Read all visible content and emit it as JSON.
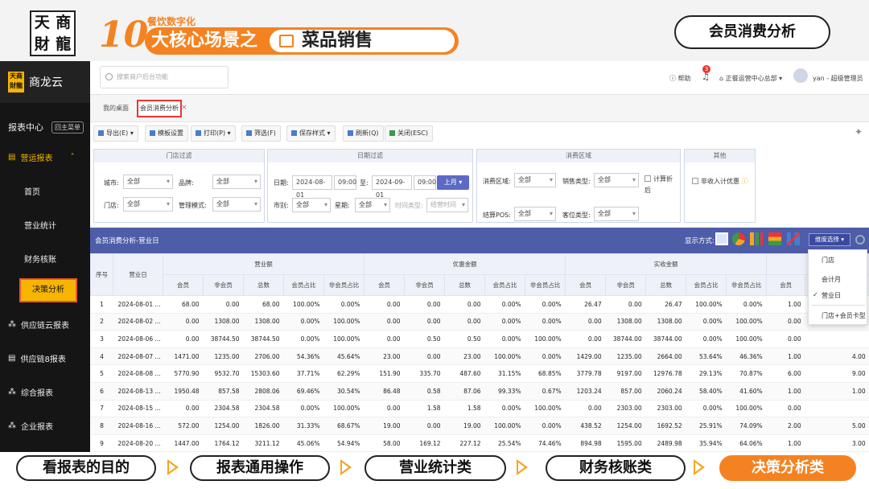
{
  "banner": {
    "logo": [
      "天",
      "商",
      "財",
      "龍"
    ],
    "big_number": "10",
    "small_title": "餐饮数字化",
    "main_title": "大核心场景之",
    "pill_title": "菜品销售",
    "topic": "会员消费分析"
  },
  "sidebar": {
    "brand": "商龙云",
    "brand_mini": "天商財龍",
    "report_center": "报表中心",
    "home_btn": "回主菜单",
    "group": "营运报表",
    "subs": [
      "首页",
      "营业统计",
      "财务核账",
      "决策分析"
    ],
    "others": [
      "供应链云报表",
      "供应链8报表",
      "综合报表",
      "企业报表"
    ]
  },
  "header": {
    "search_placeholder": "搜索商户后台功能",
    "help": "帮助",
    "bell_count": "3",
    "org": "正餐运营中心总部",
    "user": "yan - 超级管理员"
  },
  "tabs": {
    "desk": "我的桌面",
    "current": "会员消费分析",
    "close": "×"
  },
  "toolbar": [
    "导出(E)",
    "模板设置",
    "打印(P)",
    "筛选(F)",
    "保存样式",
    "刷新(Q)",
    "关闭(ESC)"
  ],
  "filters": {
    "store": {
      "head": "门店过滤",
      "city_lbl": "城市:",
      "city": "全部",
      "brand_lbl": "品牌:",
      "brand": "全部",
      "store_lbl": "门店:",
      "store": "全部",
      "mode_lbl": "管理模式:",
      "mode": "全部"
    },
    "date": {
      "head": "日期过滤",
      "date_lbl": "日期:",
      "start": "2024-08-01",
      "start_t": "09:00",
      "to": "至:",
      "end": "2024-09-01",
      "end_t": "09:00",
      "month_btn": "上月 ▾",
      "market_lbl": "市别:",
      "market": "全部",
      "week_lbl": "星期:",
      "week": "全部",
      "time_lbl": "时间类型:",
      "time": "结营时间"
    },
    "consume": {
      "head": "消费区域",
      "area_lbl": "消费区域:",
      "area": "全部",
      "sale_lbl": "销售类型:",
      "sale": "全部",
      "disc_lbl": "计算折后",
      "pos_lbl": "结算POS:",
      "pos": "全部",
      "seat_lbl": "客位类型:",
      "seat": "全部"
    },
    "other": {
      "head": "其他",
      "exclude": "非收入计优惠"
    }
  },
  "grid": {
    "title": "会员消费分析-营业日",
    "display_label": "显示方式:",
    "dim_btn": "维度选择 ▾",
    "col_index": "序号",
    "col_day": "营业日",
    "groups": [
      "营业额",
      "优惠金额",
      "实收金额"
    ],
    "sub_cols": [
      "会员",
      "非会员",
      "总数",
      "会员占比",
      "非会员占比"
    ],
    "extra_col": "会员",
    "rows": [
      [
        "1",
        "2024-08-01 ...",
        "68.00",
        "0.00",
        "68.00",
        "100.00%",
        "0.00%",
        "0.00",
        "0.00",
        "0.00",
        "0.00%",
        "0.00%",
        "26.47",
        "0.00",
        "26.47",
        "100.00%",
        "0.00%",
        "1.00"
      ],
      [
        "2",
        "2024-08-02 ...",
        "0.00",
        "1308.00",
        "1308.00",
        "0.00%",
        "100.00%",
        "0.00",
        "0.00",
        "0.00",
        "0.00%",
        "0.00%",
        "0.00",
        "1308.00",
        "1308.00",
        "0.00%",
        "100.00%",
        "0.00"
      ],
      [
        "3",
        "2024-08-06 ...",
        "0.00",
        "38744.50",
        "38744.50",
        "0.00%",
        "100.00%",
        "0.00",
        "0.50",
        "0.50",
        "0.00%",
        "100.00%",
        "0.00",
        "38744.00",
        "38744.00",
        "0.00%",
        "100.00%",
        "0.00"
      ],
      [
        "4",
        "2024-08-07 ...",
        "1471.00",
        "1235.00",
        "2706.00",
        "54.36%",
        "45.64%",
        "23.00",
        "0.00",
        "23.00",
        "100.00%",
        "0.00%",
        "1429.00",
        "1235.00",
        "2664.00",
        "53.64%",
        "46.36%",
        "1.00"
      ],
      [
        "5",
        "2024-08-08 ...",
        "5770.90",
        "9532.70",
        "15303.60",
        "37.71%",
        "62.29%",
        "151.90",
        "335.70",
        "487.60",
        "31.15%",
        "68.85%",
        "3779.78",
        "9197.00",
        "12976.78",
        "29.13%",
        "70.87%",
        "6.00"
      ],
      [
        "6",
        "2024-08-13 ...",
        "1950.48",
        "857.58",
        "2808.06",
        "69.46%",
        "30.54%",
        "86.48",
        "0.58",
        "87.06",
        "99.33%",
        "0.67%",
        "1203.24",
        "857.00",
        "2060.24",
        "58.40%",
        "41.60%",
        "1.00"
      ],
      [
        "7",
        "2024-08-15 ...",
        "0.00",
        "2304.58",
        "2304.58",
        "0.00%",
        "100.00%",
        "0.00",
        "1.58",
        "1.58",
        "0.00%",
        "100.00%",
        "0.00",
        "2303.00",
        "2303.00",
        "0.00%",
        "100.00%",
        "0.00"
      ],
      [
        "8",
        "2024-08-16 ...",
        "572.00",
        "1254.00",
        "1826.00",
        "31.33%",
        "68.67%",
        "19.00",
        "0.00",
        "19.00",
        "100.00%",
        "0.00%",
        "438.52",
        "1254.00",
        "1692.52",
        "25.91%",
        "74.09%",
        "2.00"
      ],
      [
        "9",
        "2024-08-20 ...",
        "1447.00",
        "1764.12",
        "3211.12",
        "45.06%",
        "54.94%",
        "58.00",
        "169.12",
        "227.12",
        "25.54%",
        "74.46%",
        "894.98",
        "1595.00",
        "2489.98",
        "35.94%",
        "64.06%",
        "1.00"
      ]
    ],
    "extra_partial": [
      "",
      "",
      "",
      "4.00",
      "9.00",
      "1.00",
      "",
      "5.00",
      "3.00"
    ]
  },
  "dropdown": {
    "items": [
      "门店",
      "会计月",
      "营业日",
      "门店+会员卡型"
    ],
    "check": "✓"
  },
  "bottom_nav": [
    "看报表的目的",
    "报表通用操作",
    "营业统计类",
    "财务核账类",
    "决策分析类"
  ],
  "colors": {
    "accent": "#f58220",
    "grid_header": "#4e5da8",
    "sidebar": "#151515",
    "active": "#f8b500"
  }
}
